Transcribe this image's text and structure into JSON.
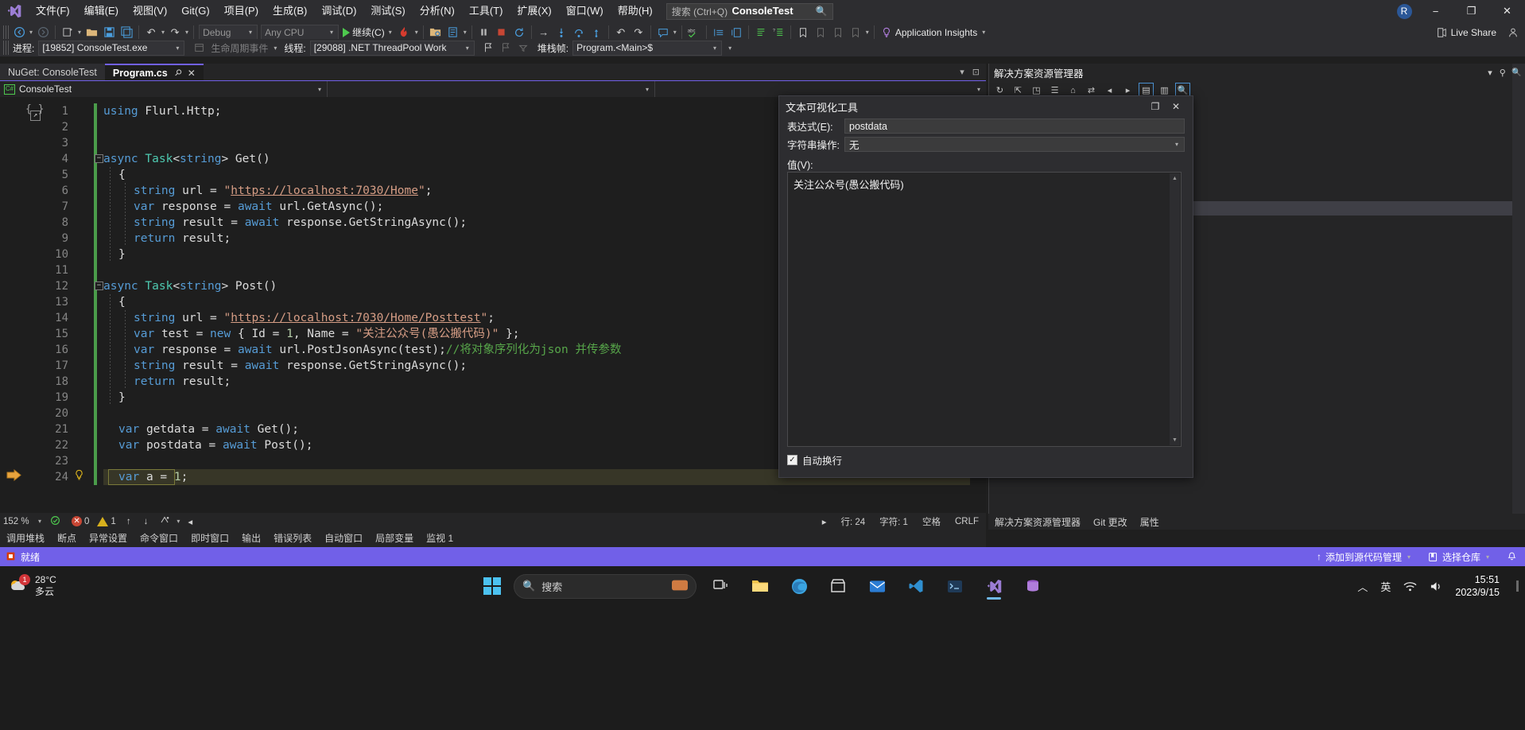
{
  "titlebar": {
    "logo_icon": "visual-studio-logo",
    "menus": [
      "文件(F)",
      "编辑(E)",
      "视图(V)",
      "Git(G)",
      "项目(P)",
      "生成(B)",
      "调试(D)",
      "测试(S)",
      "分析(N)",
      "工具(T)",
      "扩展(X)",
      "窗口(W)",
      "帮助(H)"
    ],
    "search_placeholder": "搜索 (Ctrl+Q)",
    "search_icon": "search-icon",
    "app_title": "ConsoleTest",
    "account_initial": "R",
    "minimize": "−",
    "restore": "❐",
    "close": "✕"
  },
  "toolbar": {
    "nav_back": "◀",
    "nav_forward": "▶",
    "new_project": "新建项目",
    "open_file": "打开文件",
    "save": "保存",
    "save_all": "全部保存",
    "undo": "↶",
    "redo": "↷",
    "config_value": "Debug",
    "platform_value": "Any CPU",
    "continue_label": "继续(C)",
    "hot_reload": "热重载",
    "pause": "⏸",
    "stop": "■",
    "restart": "↻",
    "step_into": "→",
    "step_over": "↴",
    "step_out": "↰",
    "app_insights_label": "Application Insights",
    "live_share_label": "Live Share"
  },
  "debugbar": {
    "process_label": "进程:",
    "process_value": "[19852] ConsoleTest.exe",
    "lifecycle_label": "生命周期事件",
    "thread_label": "线程:",
    "thread_value": "[29088] .NET ThreadPool Work",
    "stackframe_label": "堆栈帧:",
    "stackframe_value": "Program.<Main>$"
  },
  "tabs": [
    {
      "label": "NuGet: ConsoleTest",
      "active": false
    },
    {
      "label": "Program.cs",
      "active": true,
      "pin_icon": "pin-icon",
      "close_icon": "close-icon"
    }
  ],
  "navbar": {
    "project_badge": "C#",
    "project_value": "ConsoleTest",
    "type_value": "",
    "member_value": ""
  },
  "code": {
    "lines": [
      {
        "n": 1,
        "html": "<span class=\"kw\">using</span> <span class=\"pln\">Flurl.Http;</span>"
      },
      {
        "n": 2,
        "html": ""
      },
      {
        "n": 3,
        "html": ""
      },
      {
        "n": 4,
        "html": "<span class=\"kw\">async</span> <span class=\"typ\">Task</span><span class=\"pln\">&lt;</span><span class=\"kw\">string</span><span class=\"pln\">&gt; Get()</span>",
        "collapse": true
      },
      {
        "n": 5,
        "html": "<span class=\"pln\">{</span>"
      },
      {
        "n": 6,
        "html": "<span class=\"kw\">string</span> <span class=\"pln\">url = </span><span class=\"str\">\"</span><span class=\"strl\">https://localhost:7030/Home</span><span class=\"str\">\"</span><span class=\"pln\">;</span>"
      },
      {
        "n": 7,
        "html": "<span class=\"kw\">var</span> <span class=\"pln\">response = </span><span class=\"kw\">await</span> <span class=\"pln\">url.GetAsync();</span>"
      },
      {
        "n": 8,
        "html": "<span class=\"kw\">string</span> <span class=\"pln\">result = </span><span class=\"kw\">await</span> <span class=\"pln\">response.GetStringAsync();</span>"
      },
      {
        "n": 9,
        "html": "<span class=\"kw\">return</span> <span class=\"pln\">result;</span>"
      },
      {
        "n": 10,
        "html": "<span class=\"pln\">}</span>"
      },
      {
        "n": 11,
        "html": ""
      },
      {
        "n": 12,
        "html": "<span class=\"kw\">async</span> <span class=\"typ\">Task</span><span class=\"pln\">&lt;</span><span class=\"kw\">string</span><span class=\"pln\">&gt; Post()</span>",
        "collapse": true
      },
      {
        "n": 13,
        "html": "<span class=\"pln\">{</span>"
      },
      {
        "n": 14,
        "html": "<span class=\"kw\">string</span> <span class=\"pln\">url = </span><span class=\"str\">\"</span><span class=\"strl\">https://localhost:7030/Home/Posttest</span><span class=\"str\">\"</span><span class=\"pln\">;</span>"
      },
      {
        "n": 15,
        "html": "<span class=\"kw\">var</span> <span class=\"pln\">test = </span><span class=\"kw\">new</span> <span class=\"pln\">{ Id = </span><span class=\"num-lit\">1</span><span class=\"pln\">, Name = </span><span class=\"str\">\"关注公众号(愚公搬代码)\"</span> <span class=\"pln\">};</span>"
      },
      {
        "n": 16,
        "html": "<span class=\"kw\">var</span> <span class=\"pln\">response = </span><span class=\"kw\">await</span> <span class=\"pln\">url.PostJsonAsync(test);</span><span class=\"cmt\">//将对象序列化为json 并传参数</span>"
      },
      {
        "n": 17,
        "html": "<span class=\"kw\">string</span> <span class=\"pln\">result = </span><span class=\"kw\">await</span> <span class=\"pln\">response.GetStringAsync();</span>"
      },
      {
        "n": 18,
        "html": "<span class=\"kw\">return</span> <span class=\"pln\">result;</span>"
      },
      {
        "n": 19,
        "html": "<span class=\"pln\">}</span>"
      },
      {
        "n": 20,
        "html": ""
      },
      {
        "n": 21,
        "html": "<span class=\"kw\">var</span> <span class=\"pln\">getdata = </span><span class=\"kw\">await</span> <span class=\"pln\">Get();</span>"
      },
      {
        "n": 22,
        "html": "<span class=\"kw\">var</span> <span class=\"pln\">postdata = </span><span class=\"kw\">await</span> <span class=\"pln\">Post();</span>"
      },
      {
        "n": 23,
        "html": ""
      },
      {
        "n": 24,
        "html": "<span class=\"kw\">var</span> <span class=\"pln\">a = </span><span class=\"num-lit\">1</span><span class=\"pln\">;</span>",
        "current": true,
        "breakpoint": true,
        "bulb": true
      }
    ]
  },
  "editor_status": {
    "zoom": "152 %",
    "errors": "0",
    "warnings": "1",
    "up_arrow": "↑",
    "down_arrow": "↓",
    "line_label": "行: 24",
    "char_label": "字符: 1",
    "tabs_label": "空格",
    "eol_label": "CRLF"
  },
  "solution_explorer": {
    "title": "解决方案资源管理器",
    "pin_icon": "pin-icon",
    "close_icon": "close-icon",
    "search_icon": "search-icon"
  },
  "dialog": {
    "title": "文本可视化工具",
    "maximize_icon": "maximize-icon",
    "close_icon": "close-icon",
    "expression_label": "表达式(E):",
    "expression_value": "postdata",
    "string_op_label": "字符串操作:",
    "string_op_value": "无",
    "value_label": "值(V):",
    "value_text": "关注公众号(愚公搬代码)",
    "wrap_label": "自动换行",
    "wrap_checked": "✓"
  },
  "tool_window_tabs": [
    "调用堆栈",
    "断点",
    "异常设置",
    "命令窗口",
    "即时窗口",
    "输出",
    "错误列表",
    "自动窗口",
    "局部变量",
    "监视 1"
  ],
  "vs_status": {
    "ready": "就绪",
    "add_to_source_label": "添加到源代码管理",
    "select_repo_label": "选择仓库",
    "bell_icon": "bell-icon",
    "up_icon": "↑"
  },
  "status_right_extra": [
    "解决方案资源管理器",
    "Git 更改",
    "属性"
  ],
  "taskbar": {
    "weather_temp": "28°C",
    "weather_desc": "多云",
    "weather_icon": "partly-cloudy-icon",
    "weather_badge": "1",
    "start_icon": "windows-start-icon",
    "search_placeholder": "搜索",
    "search_icon": "search-icon",
    "apps": [
      "task-view-icon",
      "widgets-icon",
      "file-explorer-icon",
      "edge-icon",
      "store-icon",
      "mail-icon",
      "vscode-icon",
      "terminal-icon",
      "visual-studio-icon",
      "sql-icon"
    ],
    "tray_chevron": "︿",
    "tray_ime": "英",
    "tray_network_icon": "network-icon",
    "tray_volume_icon": "volume-icon",
    "clock_time": "15:51",
    "clock_date": "2023/9/15"
  },
  "colors": {
    "accent": "#7160e8",
    "titlebar_bg": "#2d2d30",
    "editor_bg": "#1e1e1e",
    "keyword": "#569cd6",
    "type": "#4ec9b0",
    "string": "#d69d85",
    "comment": "#57a64a"
  }
}
